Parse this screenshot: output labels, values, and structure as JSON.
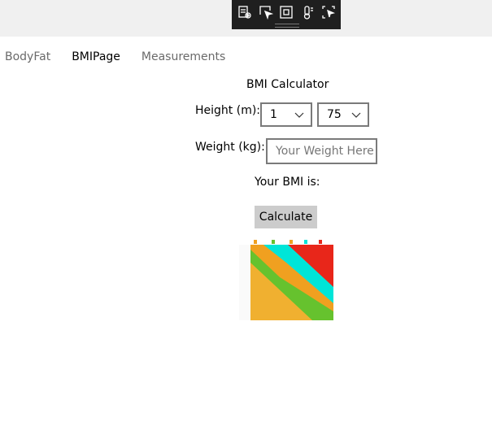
{
  "toolbar": {
    "buttons": [
      {
        "icon": "live-visual-tree-icon"
      },
      {
        "icon": "select-element-icon"
      },
      {
        "icon": "display-layout-adorners-icon"
      },
      {
        "icon": "track-focused-element-icon"
      },
      {
        "icon": "show-layout-icon"
      }
    ]
  },
  "nav": {
    "items": [
      {
        "label": "BodyFat",
        "active": false
      },
      {
        "label": "BMIPage",
        "active": true
      },
      {
        "label": "Measurements",
        "active": false
      }
    ]
  },
  "page": {
    "title": "BMI Calculator",
    "height_label": "Height (m):",
    "height_meters_value": "1",
    "height_cm_value": "75",
    "weight_label": "Weight (kg):",
    "weight_placeholder": "Your Weight Here",
    "weight_value": "",
    "result_label": "Your BMI is:",
    "calculate_label": "Calculate"
  },
  "colors": {
    "debug_toolbar_bg": "#1f1f1f",
    "topbar_bg": "#f0f0f0",
    "button_bg": "#cccccc",
    "bmi_underweight": "#00e5d8",
    "bmi_normal": "#66c22e",
    "bmi_overweight": "#f0a020",
    "bmi_obese": "#e8261a"
  }
}
